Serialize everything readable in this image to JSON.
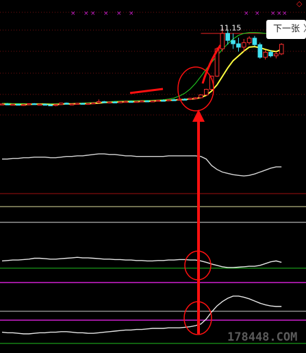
{
  "next_button": {
    "label": "下一张",
    "chevron": "〉"
  },
  "watermark": "178448.COM",
  "corner_icon": {
    "name": "diamond-icon",
    "glyph": "◇"
  },
  "colors": {
    "background": "#000000",
    "up": "#ff3030",
    "down": "#40e0f0",
    "ma5": "#ffff40",
    "ma10": "#20c020",
    "indicator": "#e8e8e8",
    "annotation": "#ff1010",
    "magenta": "#d020d0",
    "grid": "#ffffff",
    "green_line": "#20c020"
  },
  "chart_data": [
    {
      "type": "candlestick",
      "candles": [
        [
          8.42,
          8.46,
          8.4,
          8.44
        ],
        [
          8.44,
          8.47,
          8.4,
          8.41
        ],
        [
          8.41,
          8.45,
          8.38,
          8.43
        ],
        [
          8.43,
          8.45,
          8.4,
          8.4
        ],
        [
          8.4,
          8.44,
          8.37,
          8.42
        ],
        [
          8.42,
          8.46,
          8.39,
          8.45
        ],
        [
          8.45,
          8.47,
          8.41,
          8.42
        ],
        [
          8.42,
          8.45,
          8.39,
          8.43
        ],
        [
          8.43,
          8.45,
          8.4,
          8.41
        ],
        [
          8.41,
          8.44,
          8.37,
          8.4
        ],
        [
          8.4,
          8.43,
          8.36,
          8.42
        ],
        [
          8.42,
          8.48,
          8.4,
          8.47
        ],
        [
          8.47,
          8.49,
          8.42,
          8.43
        ],
        [
          8.43,
          8.46,
          8.4,
          8.44
        ],
        [
          8.44,
          8.48,
          8.42,
          8.46
        ],
        [
          8.46,
          8.48,
          8.43,
          8.44
        ],
        [
          8.44,
          8.47,
          8.41,
          8.46
        ],
        [
          8.46,
          8.5,
          8.44,
          8.48
        ],
        [
          8.48,
          8.6,
          8.45,
          8.52
        ],
        [
          8.52,
          8.55,
          8.47,
          8.49
        ],
        [
          8.49,
          8.53,
          8.46,
          8.51
        ],
        [
          8.51,
          8.54,
          8.48,
          8.5
        ],
        [
          8.5,
          8.53,
          8.47,
          8.52
        ],
        [
          8.52,
          8.56,
          8.5,
          8.53
        ],
        [
          8.53,
          8.55,
          8.5,
          8.51
        ],
        [
          8.51,
          8.54,
          8.49,
          8.53
        ],
        [
          8.53,
          8.57,
          8.51,
          8.55
        ],
        [
          8.55,
          8.57,
          8.52,
          8.53
        ],
        [
          8.53,
          8.56,
          8.51,
          8.55
        ],
        [
          8.55,
          8.58,
          8.53,
          8.57
        ],
        [
          8.57,
          8.6,
          8.54,
          8.56
        ],
        [
          8.56,
          8.6,
          8.54,
          8.59
        ],
        [
          8.59,
          8.62,
          8.56,
          8.58
        ],
        [
          8.58,
          8.63,
          8.56,
          8.61
        ],
        [
          8.61,
          8.64,
          8.58,
          8.6
        ],
        [
          8.6,
          8.66,
          8.58,
          8.64
        ],
        [
          8.64,
          8.68,
          8.61,
          8.66
        ],
        [
          8.66,
          8.78,
          8.64,
          8.76
        ],
        [
          8.76,
          8.98,
          8.74,
          8.96
        ],
        [
          8.96,
          9.45,
          8.94,
          9.43
        ],
        [
          9.43,
          10.45,
          9.4,
          10.4
        ],
        [
          10.4,
          11.15,
          10.3,
          10.95
        ],
        [
          10.95,
          11.05,
          10.55,
          10.7
        ],
        [
          10.7,
          10.95,
          10.4,
          10.58
        ],
        [
          10.58,
          10.8,
          10.3,
          10.46
        ],
        [
          10.46,
          10.75,
          10.3,
          10.62
        ],
        [
          10.62,
          10.85,
          10.55,
          10.78
        ],
        [
          10.78,
          10.86,
          10.5,
          10.55
        ],
        [
          10.55,
          10.62,
          10.05,
          10.1
        ],
        [
          10.1,
          10.35,
          10.02,
          10.28
        ],
        [
          10.28,
          10.36,
          10.1,
          10.15
        ],
        [
          10.15,
          10.3,
          10.06,
          10.22
        ],
        [
          10.22,
          10.6,
          10.18,
          10.56
        ]
      ],
      "ma5": [
        8.43,
        8.43,
        8.42,
        8.42,
        8.42,
        8.42,
        8.43,
        8.43,
        8.43,
        8.42,
        8.42,
        8.43,
        8.44,
        8.44,
        8.45,
        8.45,
        8.45,
        8.46,
        8.47,
        8.49,
        8.5,
        8.5,
        8.51,
        8.52,
        8.52,
        8.52,
        8.53,
        8.53,
        8.54,
        8.55,
        8.56,
        8.57,
        8.58,
        8.59,
        8.6,
        8.61,
        8.63,
        8.67,
        8.75,
        8.9,
        9.12,
        9.42,
        9.72,
        9.98,
        10.15,
        10.32,
        10.46,
        10.48,
        10.44,
        10.38,
        10.33,
        10.3,
        10.38
      ],
      "ma10": [
        8.46,
        8.46,
        8.45,
        8.45,
        8.45,
        8.44,
        8.44,
        8.44,
        8.44,
        8.44,
        8.44,
        8.44,
        8.45,
        8.45,
        8.46,
        8.47,
        8.48,
        8.49,
        8.5,
        8.51,
        8.52,
        8.53,
        8.54,
        8.54,
        8.55,
        8.55,
        8.56,
        8.56,
        8.57,
        8.58,
        8.59,
        8.61,
        8.65,
        8.72,
        8.82,
        8.97,
        9.17,
        9.42,
        9.68,
        9.92,
        10.15,
        10.38,
        10.58,
        10.75,
        10.88,
        10.95,
        10.98,
        10.98,
        10.97,
        10.95,
        10.94,
        10.93,
        10.93
      ],
      "resistance_level": 10.95,
      "annotation_label": "11.15",
      "ylim": [
        8.0,
        11.7
      ]
    },
    {
      "type": "line",
      "name": "",
      "values": [
        50,
        50,
        51,
        51,
        52,
        52,
        53,
        53,
        53,
        52,
        52,
        53,
        54,
        54,
        55,
        55,
        56,
        57,
        58,
        58,
        57,
        57,
        56,
        55,
        55,
        54,
        54,
        54,
        54,
        54,
        54,
        55,
        55,
        55,
        55,
        55,
        55,
        54,
        50,
        40,
        34,
        30,
        28,
        26,
        25,
        24,
        25,
        27,
        30,
        33,
        36,
        38,
        38
      ],
      "ylim": [
        0,
        100
      ]
    },
    {
      "type": "line",
      "name": "",
      "values": [
        44,
        45,
        46,
        46,
        47,
        48,
        50,
        50,
        49,
        48,
        48,
        49,
        50,
        51,
        52,
        51,
        51,
        50,
        49,
        48,
        48,
        47,
        47,
        46,
        46,
        45,
        45,
        44,
        44,
        45,
        45,
        46,
        46,
        47,
        47,
        46,
        46,
        44,
        41,
        37,
        34,
        31,
        29,
        29,
        30,
        31,
        32,
        32,
        34,
        38,
        42,
        44,
        41
      ],
      "ylim": [
        0,
        100
      ]
    },
    {
      "type": "line",
      "name": "",
      "values": [
        18,
        17,
        17,
        16,
        15,
        15,
        16,
        17,
        17,
        18,
        18,
        19,
        19,
        18,
        17,
        17,
        16,
        16,
        17,
        18,
        19,
        20,
        21,
        22,
        22,
        23,
        23,
        24,
        25,
        25,
        25,
        26,
        26,
        26,
        27,
        28,
        30,
        33,
        42,
        55,
        66,
        74,
        80,
        84,
        84,
        82,
        79,
        75,
        71,
        68,
        66,
        65,
        65
      ],
      "ylim": [
        0,
        100
      ]
    }
  ]
}
